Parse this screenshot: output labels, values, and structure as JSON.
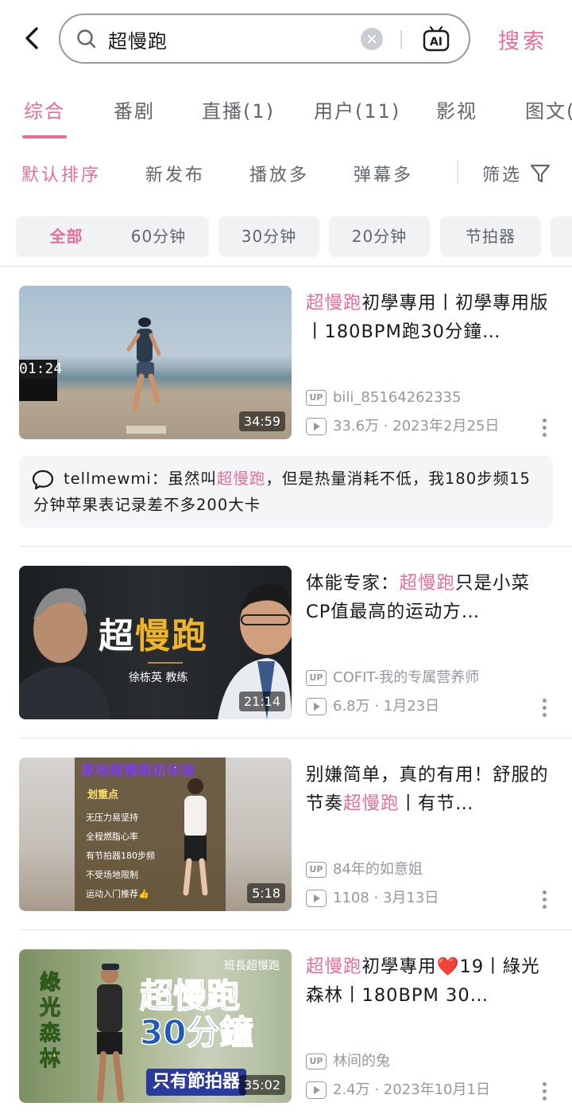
{
  "search": {
    "query": "超慢跑",
    "submit_label": "搜索"
  },
  "tabs": [
    "综合",
    "番剧",
    "直播(1)",
    "用户(11)",
    "影视",
    "图文("
  ],
  "sorts": [
    "默认排序",
    "新发布",
    "播放多",
    "弹幕多"
  ],
  "filter_label": "筛选",
  "chips": [
    "全部",
    "60分钟",
    "30分钟",
    "20分钟",
    "节拍器"
  ],
  "videos": [
    {
      "title_hl": "超慢跑",
      "title_rest": "初學專用丨初學專用版丨180BPM跑30分鐘…",
      "author": "bili_85164262335",
      "stats": "33.6万 · 2023年2月25日",
      "duration": "34:59",
      "thumb_overlay": "01:24"
    },
    {
      "title_pre": "体能专家：",
      "title_hl": "超慢跑",
      "title_rest": "只是小菜 CP值最高的运动方…",
      "author": "COFIT-我的专属营养师",
      "stats": "6.8万 · 1月23日",
      "duration": "21:14",
      "thumb_title_a": "超",
      "thumb_title_b": "慢跑",
      "thumb_sub": "徐栋英 教练"
    },
    {
      "title_pre": "别嫌简单，真的有用！舒服的节奏",
      "title_hl": "超慢跑",
      "title_rest": "丨有节…",
      "author": "84年的如意姐",
      "stats": "1108 · 3月13日",
      "duration": "5:18",
      "thumb_banner": "原地超慢跑初体验",
      "thumb_label": "划重点",
      "thumb_points": [
        "无压力易坚持",
        "全程燃脂心率",
        "有节拍器180步频",
        "不受场地限制",
        "运动入门推荐👍"
      ]
    },
    {
      "title_hl": "超慢跑",
      "title_rest": "初學專用❤️19丨綠光森林丨180BPM 30…",
      "author": "林间的兔",
      "stats": "2.4万 · 2023年10月1日",
      "duration": "35:02",
      "thumb_tag": "班長超慢跑",
      "thumb_vertical": "綠光森林",
      "thumb_big1": "超慢跑",
      "thumb_big2": "30分鐘",
      "thumb_banner": "只有節拍器"
    }
  ],
  "comment": {
    "user": "tellmewmi：",
    "pre": "虽然叫",
    "hl": "超慢跑",
    "rest": "，但是热量消耗不低，我180步频15分钟苹果表记录差不多200大卡"
  },
  "colors": {
    "accent": "#e46e9c",
    "text": "#18191c",
    "muted": "#9499a0"
  }
}
